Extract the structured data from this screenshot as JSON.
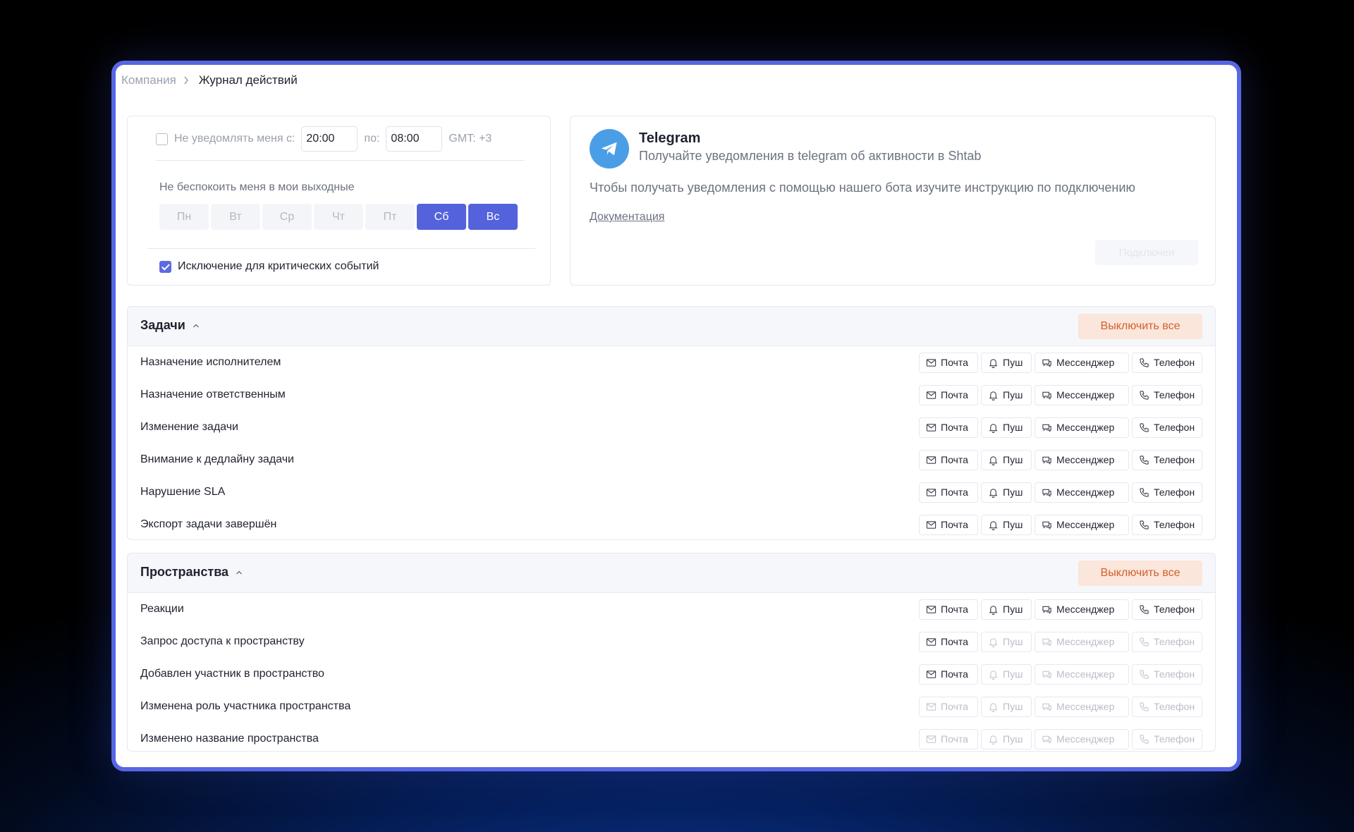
{
  "breadcrumb": {
    "parent": "Компания",
    "current": "Журнал действий"
  },
  "dnd": {
    "label": "Не уведомлять меня с:",
    "from": "20:00",
    "to_label": "по:",
    "to": "08:00",
    "timezone": "GMT: +3",
    "weekend_label": "Не беспокоить меня в мои выходные",
    "days": [
      {
        "label": "Пн",
        "active": false
      },
      {
        "label": "Вт",
        "active": false
      },
      {
        "label": "Ср",
        "active": false
      },
      {
        "label": "Чт",
        "active": false
      },
      {
        "label": "Пт",
        "active": false
      },
      {
        "label": "Сб",
        "active": true
      },
      {
        "label": "Вс",
        "active": true
      }
    ],
    "critical_label": "Исключение для критических событий"
  },
  "telegram": {
    "title": "Telegram",
    "subtitle": "Получайте уведомления в telegram об активности в Shtab",
    "description": "Чтобы получать уведомления с помощью нашего бота изучите инструкцию по подключению",
    "doc_link": "Документация",
    "button": "Подключен"
  },
  "channel_labels": {
    "mail": "Почта",
    "push": "Пуш",
    "messenger": "Мессенджер",
    "phone": "Телефон"
  },
  "sections": [
    {
      "title": "Задачи",
      "off_all": "Выключить все",
      "rows": [
        {
          "label": "Назначение исполнителем",
          "enabled": [
            true,
            true,
            true,
            true
          ]
        },
        {
          "label": "Назначение ответственным",
          "enabled": [
            true,
            true,
            true,
            true
          ]
        },
        {
          "label": "Изменение задачи",
          "enabled": [
            true,
            true,
            true,
            true
          ]
        },
        {
          "label": "Внимание к дедлайну задачи",
          "enabled": [
            true,
            true,
            true,
            true
          ]
        },
        {
          "label": "Нарушение SLA",
          "enabled": [
            true,
            true,
            true,
            true
          ]
        },
        {
          "label": "Экспорт задачи завершён",
          "enabled": [
            true,
            true,
            true,
            true
          ]
        }
      ]
    },
    {
      "title": "Пространства",
      "off_all": "Выключить все",
      "rows": [
        {
          "label": "Реакции",
          "enabled": [
            true,
            true,
            true,
            true
          ]
        },
        {
          "label": "Запрос доступа к пространству",
          "enabled": [
            true,
            false,
            false,
            false
          ]
        },
        {
          "label": "Добавлен участник в пространство",
          "enabled": [
            true,
            false,
            false,
            false
          ]
        },
        {
          "label": "Изменена роль участника пространства",
          "enabled": [
            false,
            false,
            false,
            false
          ]
        },
        {
          "label": "Изменено название пространства",
          "enabled": [
            false,
            false,
            false,
            false
          ]
        }
      ]
    }
  ]
}
